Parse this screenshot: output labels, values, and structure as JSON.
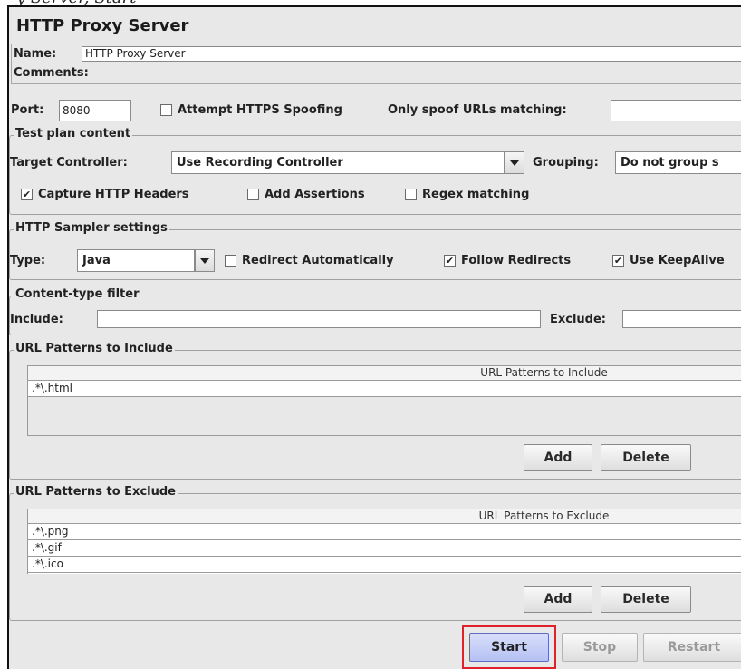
{
  "header_cut_text": "y Server, Start",
  "title": "HTTP Proxy Server",
  "name": {
    "label": "Name:",
    "value": "HTTP Proxy Server"
  },
  "comments": {
    "label": "Comments:"
  },
  "port": {
    "label": "Port:",
    "value": "8080"
  },
  "https_spoofing": {
    "label": "Attempt HTTPS Spoofing",
    "checked": false
  },
  "spoof_urls": {
    "label": "Only spoof URLs matching:",
    "value": ""
  },
  "test_plan": {
    "legend": "Test plan content",
    "target_label": "Target Controller:",
    "target_value": "Use Recording Controller",
    "grouping_label": "Grouping:",
    "grouping_value": "Do not group s",
    "capture_headers": {
      "label": "Capture HTTP Headers",
      "checked": true
    },
    "add_assertions": {
      "label": "Add Assertions",
      "checked": false
    },
    "regex_matching": {
      "label": "Regex matching",
      "checked": false
    }
  },
  "sampler": {
    "legend": "HTTP Sampler settings",
    "type_label": "Type:",
    "type_value": "Java",
    "redirect_auto": {
      "label": "Redirect Automatically",
      "checked": false
    },
    "follow_redirects": {
      "label": "Follow Redirects",
      "checked": true
    },
    "keepalive": {
      "label": "Use KeepAlive",
      "checked": true
    }
  },
  "content_filter": {
    "legend": "Content-type filter",
    "include_label": "Include:",
    "include_value": "",
    "exclude_label": "Exclude:",
    "exclude_value": ""
  },
  "include_patterns": {
    "legend": "URL Patterns to Include",
    "column": "URL Patterns to Include",
    "rows": [
      ".*\\.html"
    ],
    "add_label": "Add",
    "delete_label": "Delete"
  },
  "exclude_patterns": {
    "legend": "URL Patterns to Exclude",
    "column": "URL Patterns to Exclude",
    "rows": [
      ".*\\.png",
      ".*\\.gif",
      ".*\\.ico"
    ],
    "add_label": "Add",
    "delete_label": "Delete"
  },
  "controls": {
    "start": "Start",
    "stop": "Stop",
    "restart": "Restart"
  },
  "check_glyph": "✔",
  "colors": {
    "highlight": "#e0202a",
    "start_button": "#b6c1f4"
  }
}
